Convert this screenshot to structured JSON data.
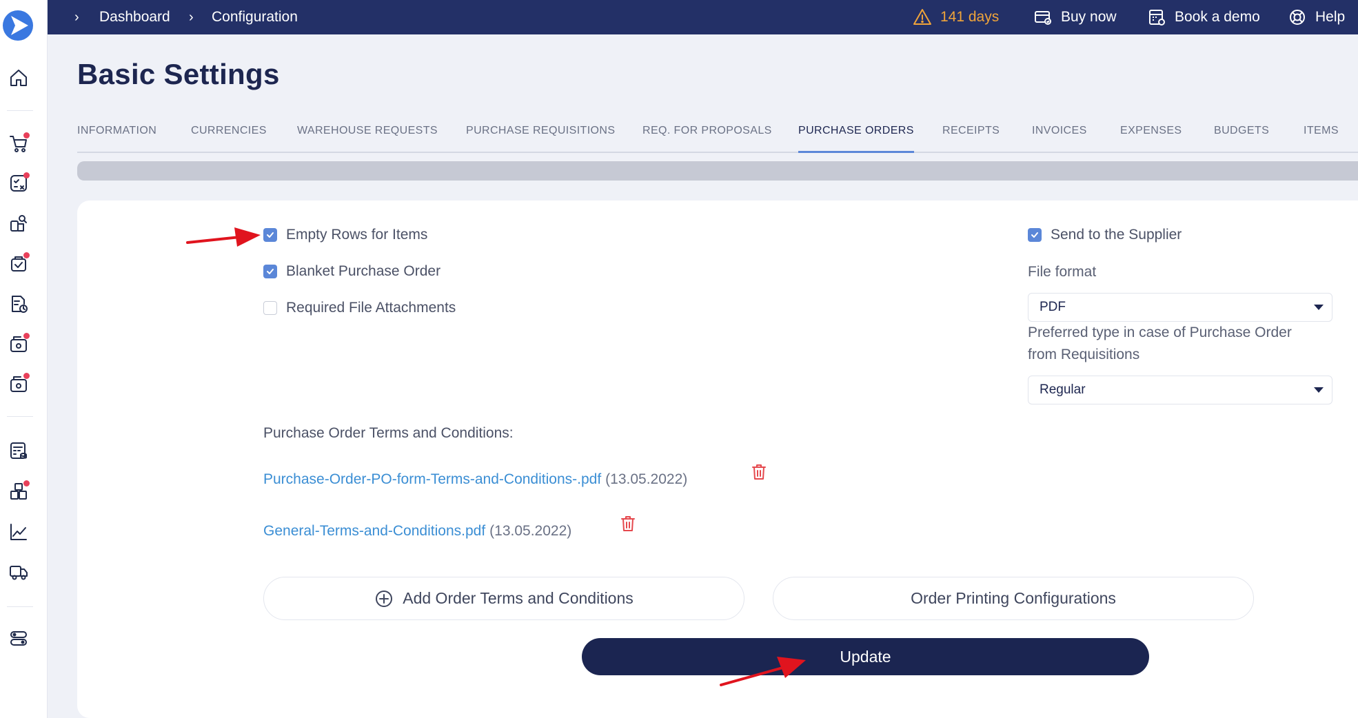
{
  "breadcrumb": {
    "items": [
      "Dashboard",
      "Configuration"
    ]
  },
  "topbar": {
    "trial": "141 days",
    "buy_now": "Buy now",
    "book_demo": "Book a demo",
    "help": "Help"
  },
  "page": {
    "title": "Basic Settings"
  },
  "tabs": [
    {
      "label": "INFORMATION"
    },
    {
      "label": "CURRENCIES"
    },
    {
      "label": "WAREHOUSE REQUESTS"
    },
    {
      "label": "PURCHASE REQUISITIONS"
    },
    {
      "label": "REQ. FOR PROPOSALS"
    },
    {
      "label": "PURCHASE ORDERS",
      "active": true
    },
    {
      "label": "RECEIPTS"
    },
    {
      "label": "INVOICES"
    },
    {
      "label": "EXPENSES"
    },
    {
      "label": "BUDGETS"
    },
    {
      "label": "ITEMS"
    }
  ],
  "options": {
    "empty_rows": {
      "label": "Empty Rows for Items",
      "checked": true
    },
    "blanket_po": {
      "label": "Blanket Purchase Order",
      "checked": true
    },
    "required_files": {
      "label": "Required File Attachments",
      "checked": false
    },
    "send_supplier": {
      "label": "Send to the Supplier",
      "checked": true
    }
  },
  "file_format": {
    "label": "File format",
    "value": "PDF"
  },
  "preferred_type": {
    "label_line1": "Preferred type in case of Purchase Order",
    "label_line2": "from Requisitions",
    "value": "Regular"
  },
  "terms": {
    "label": "Purchase Order Terms and Conditions:",
    "files": [
      {
        "name": "Purchase-Order-PO-form-Terms-and-Conditions-.pdf",
        "date": "(13.05.2022)"
      },
      {
        "name": "General-Terms-and-Conditions.pdf",
        "date": "(13.05.2022)"
      }
    ]
  },
  "buttons": {
    "add_terms": "Add Order Terms and Conditions",
    "printing": "Order Printing Configurations",
    "update": "Update"
  },
  "colors": {
    "topbar": "#233067",
    "accent": "#5b87d8",
    "link": "#3b8ed4",
    "primary_button": "#1b2551",
    "warning": "#f0a43a",
    "annotation_arrow": "#e0141e"
  }
}
